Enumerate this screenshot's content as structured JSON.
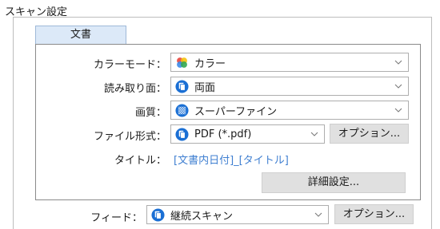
{
  "section": {
    "title": "スキャン設定"
  },
  "tab": {
    "label": "文書"
  },
  "fields": {
    "color_mode": {
      "label": "カラーモード：",
      "value": "カラー",
      "icon": "color-mode-icon"
    },
    "sides": {
      "label": "読み取り面：",
      "value": "両面",
      "icon": "duplex-icon"
    },
    "quality": {
      "label": "画質：",
      "value": "スーパーファイン",
      "icon": "quality-icon"
    },
    "file_format": {
      "label": "ファイル形式：",
      "value": "PDF (*.pdf)",
      "icon": "pdf-icon",
      "option_button": "オプション..."
    },
    "title": {
      "label": "タイトル：",
      "value": "[文書内日付]_[タイトル]"
    }
  },
  "detail_button": "詳細設定...",
  "feed": {
    "label": "フィード：",
    "value": "継続スキャン",
    "icon": "continuous-scan-icon",
    "option_button": "オプション..."
  },
  "colors": {
    "accent": "#1a6fd4",
    "link": "#3f7fd1",
    "tab_bg": "#dce9f8",
    "button_bg": "#e0e0e0"
  }
}
